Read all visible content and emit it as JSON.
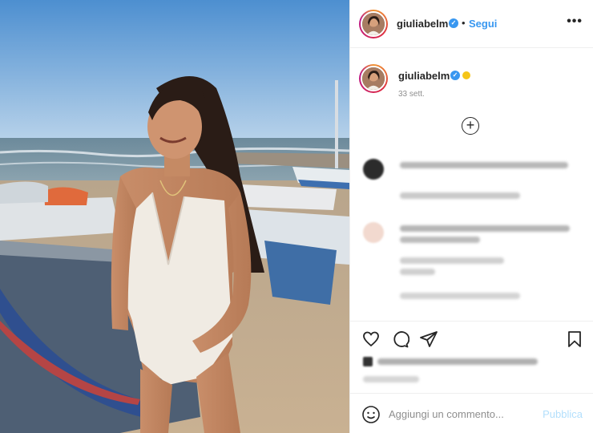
{
  "post": {
    "author": {
      "username": "giuliabelm",
      "verified_icon": "verified-badge-icon",
      "follow_label": "Segui",
      "separator": "•"
    },
    "more_icon": "more-options-icon",
    "more_label": "•••"
  },
  "caption": {
    "username": "giuliabelm",
    "emoji": "sun-emoji",
    "time": "33 sett.",
    "load_more_icon": "plus-circle-icon",
    "load_more_symbol": "+"
  },
  "actions": {
    "like_icon": "heart-icon",
    "comment_icon": "comment-icon",
    "share_icon": "send-icon",
    "save_icon": "bookmark-icon"
  },
  "comment_box": {
    "emoji_icon": "smiley-icon",
    "placeholder": "Aggiungi un commento...",
    "publish_label": "Pubblica"
  },
  "colors": {
    "accent": "#3897f0",
    "publish_disabled": "#b2dffc",
    "border": "#efefef",
    "muted": "#8e8e8e"
  }
}
